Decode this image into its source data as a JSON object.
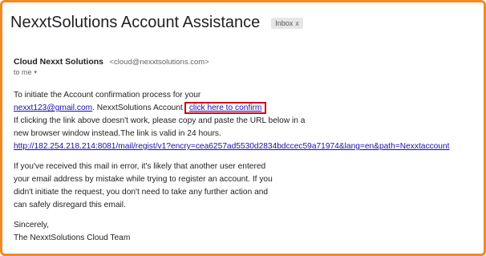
{
  "email": {
    "subject": "NexxtSolutions Account Assistance",
    "label_chip": "Inbox",
    "label_chip_close": "x",
    "sender_name": "Cloud Nexxt Solutions",
    "sender_email": "<cloud@nexxtsolutions.com>",
    "to_text": "to me",
    "to_caret": "▾",
    "body": {
      "line1": "To initiate the Account confirmation process for your",
      "line2_link": "nexxt123@gmail.com",
      "line2_text": ". NexxtSolutions Account",
      "confirm_link": "click here to confirm",
      "line3": "If clicking the link above doesn't work, please copy and paste the URL below in a",
      "line4": "new browser window instead.The link is valid in 24 hours.",
      "url": "http://182.254.218.214:8081/mail/regist/v1?encry=cea6257ad5530d2834bdccec59a71974&lang=en&path=Nexxtaccount",
      "para2_line1": "If you've received this mail in error, it's likely that another user entered",
      "para2_line2": "your email address by mistake while trying to register an account. If you",
      "para2_line3": "didn't initiate the request, you don't need to take any further action and",
      "para2_line4": "can safely disregard this email.",
      "signoff": "Sincerely,",
      "signature": "The NexxtSolutions Cloud Team"
    }
  },
  "colors": {
    "frame_border": "#f08a24",
    "highlight_box": "#d0021b",
    "link": "#1a0dab"
  }
}
